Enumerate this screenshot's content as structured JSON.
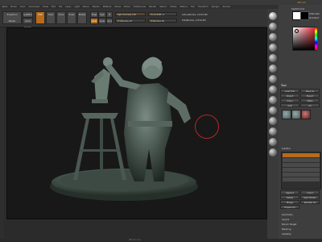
{
  "window": {
    "title": "ZBrush 3.12  [Sculpt Statue Project]   ZBrush Document   Free Mem 1.248+GB  Used Mem 420MB   PolyCount 2.034 Mp",
    "brand": "ZBrush"
  },
  "menu": [
    "Alpha",
    "Brush",
    "Color",
    "Document",
    "Draw",
    "Edit",
    "File",
    "Layer",
    "Light",
    "Macro",
    "Marker",
    "Material",
    "Movie",
    "Picker",
    "Preferences",
    "Render",
    "Stencil",
    "Stroke",
    "Texture",
    "Tool",
    "Transform",
    "Zplugin",
    "Zscript"
  ],
  "shelf": {
    "projection": "Projection Master",
    "lightbox": "LightBox",
    "quicksketch": "Quick Sketch",
    "edit": "Edit",
    "draw": "Draw",
    "move": "Move",
    "scale": "Scale",
    "rotate": "Rotate",
    "mrgb": "Mrgb",
    "rgb": "Rgb",
    "m": "M",
    "zadd": "Zadd",
    "zsub": "Zsub",
    "zcut": "Zcut",
    "rgb_intensity": "Rgb Intensity 100",
    "z_intensity": "Z Intensity 25",
    "focal_shift": "Focal Shift -6",
    "draw_size": "Draw Size 50",
    "active_points": "ActivePoints: 2.034 Mil",
    "total_points": "TotalPoints: 2.034 Mil"
  },
  "right_tray": {
    "switch_color": "SwitchColor",
    "alternate": "Alternate",
    "gradient": "Gradient",
    "tool_header": "Tool",
    "load_tool": "Load Tool",
    "save_as": "Save As",
    "import": "Import",
    "export": "Export",
    "clone": "Clone",
    "make_polymesh": "Make PolyMesh3D",
    "goz": "GoZ",
    "all": "All",
    "subtool": "SubTool",
    "geometry": "Geometry",
    "layers": "Layers",
    "morph": "Morph Target",
    "masking": "Masking",
    "visibility": "Visibility",
    "polygroups": "Polygroups",
    "contact": "Contact",
    "display": "Display Properties",
    "append": "Append",
    "insert": "Insert",
    "delete": "Delete",
    "split_hidden": "Split Hidden",
    "merge": "Merge",
    "remesh": "Remesh All",
    "project": "Project All"
  },
  "icons": [
    "sphere-brush",
    "sphere-material",
    "sphere-material",
    "sphere-material",
    "sphere-material",
    "sphere-material",
    "sphere-material",
    "sphere-material",
    "sphere-material",
    "sphere-material",
    "sphere-material",
    "sphere-material",
    "sphere-material",
    "sphere-material",
    "sphere-material",
    "sphere-material"
  ],
  "colors": {
    "accent": "#b86a1a",
    "cursor": "#b02828",
    "canvas": "#181818",
    "sculpt": "#4a5a52"
  },
  "footer": "ZBrush 3.12"
}
